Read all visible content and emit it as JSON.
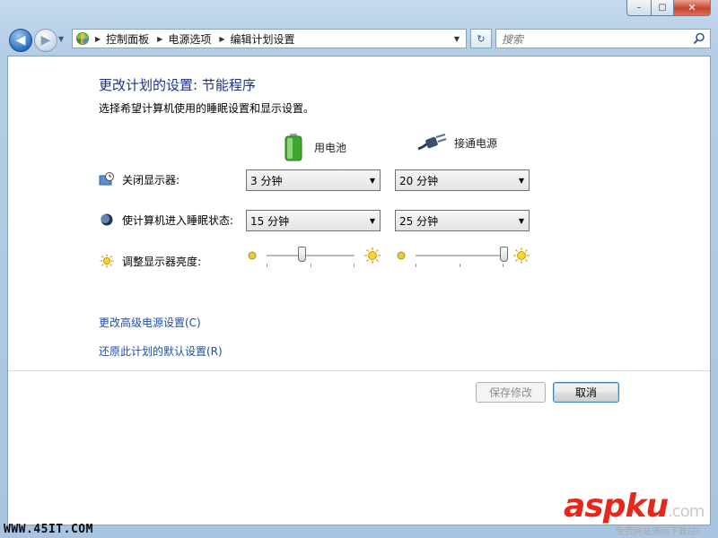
{
  "window": {
    "min_glyph": "–",
    "max_glyph": "▢",
    "close_glyph": "✕"
  },
  "nav": {
    "back_glyph": "◀",
    "forward_glyph": "▶",
    "history_glyph": "▼",
    "breadcrumbs": [
      "控制面板",
      "电源选项",
      "编辑计划设置"
    ],
    "crumb_sep_glyph": "▶",
    "addr_drop_glyph": "▼",
    "refresh_glyph": "↻",
    "search_placeholder": "搜索"
  },
  "page": {
    "title": "更改计划的设置: 节能程序",
    "subtitle": "选择希望计算机使用的睡眠设置和显示设置。",
    "columns": {
      "battery": "用电池",
      "plugged": "接通电源"
    },
    "rows": {
      "display_label": "关闭显示器:",
      "sleep_label": "使计算机进入睡眠状态:",
      "brightness_label": "调整显示器亮度:"
    },
    "display_off": {
      "battery": "3 分钟",
      "plugged": "20 分钟"
    },
    "sleep": {
      "battery": "15 分钟",
      "plugged": "25 分钟"
    },
    "brightness": {
      "battery": 0.4,
      "plugged": 1.0
    },
    "dropdown_arrow": "▼",
    "links": {
      "advanced": "更改高级电源设置(C)",
      "restore": "还原此计划的默认设置(R)"
    },
    "buttons": {
      "save": "保存修改",
      "cancel": "取消"
    }
  },
  "watermark": {
    "left_text": "WWW.45IT.COM",
    "logo_a": "asp",
    "logo_b": "ku",
    "logo_c": ".com",
    "sub": "免费网站源码下载站!"
  },
  "colors": {
    "title": "#1e3287",
    "link": "#1f4fa3",
    "frame": "#b3cde6"
  }
}
